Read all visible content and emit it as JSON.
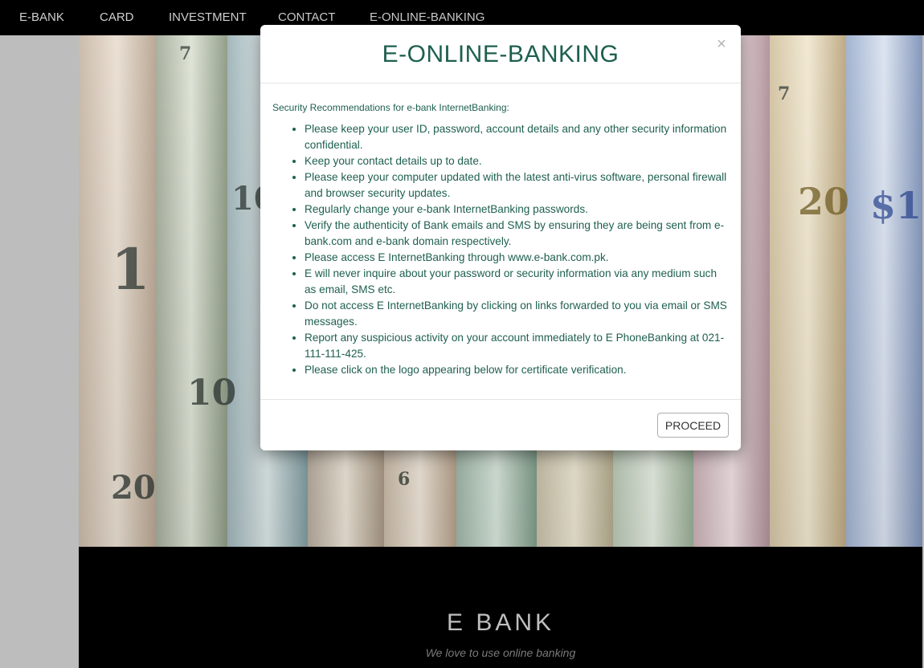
{
  "nav": {
    "items": [
      "E-BANK",
      "CARD",
      "INVESTMENT",
      "CONTACT",
      "E-ONLINE-BANKING"
    ]
  },
  "hero": {
    "image_alt": "Rolled banknotes of various currencies",
    "note_labels": [
      "7",
      "10",
      "1",
      "20",
      "$1",
      "6",
      "10",
      "20",
      "7"
    ]
  },
  "footer": {
    "title": "E BANK",
    "tagline": "We love to use online banking"
  },
  "modal": {
    "title": "E-ONLINE-BANKING",
    "close_symbol": "×",
    "intro": "Security Recommendations for e-bank InternetBanking:",
    "recommendations": [
      "Please keep your user ID, password, account details and any other security information confidential.",
      "Keep your contact details up to date.",
      "Please keep your computer updated with the latest anti-virus software, personal firewall and browser security updates.",
      "Regularly change your e-bank InternetBanking passwords.",
      "Verify the authenticity of Bank emails and SMS by ensuring they are being sent from e-bank.com and e-bank domain respectively.",
      "Please access E InternetBanking through www.e-bank.com.pk.",
      "E will never inquire about your password or security information via any medium such as email, SMS etc.",
      "Do not access E InternetBanking by clicking on links forwarded to you via email or SMS messages.",
      "Report any suspicious activity on your account immediately to E PhoneBanking at 021-111-111-425.",
      "Please click on the logo appearing below for certificate verification."
    ],
    "proceed_label": "PROCEED"
  },
  "colors": {
    "nav_bg": "#000000",
    "nav_text": "#cfcfcf",
    "modal_accent": "#1e5f4f",
    "footer_bg": "#000000",
    "page_bg": "#bdbdbd"
  }
}
